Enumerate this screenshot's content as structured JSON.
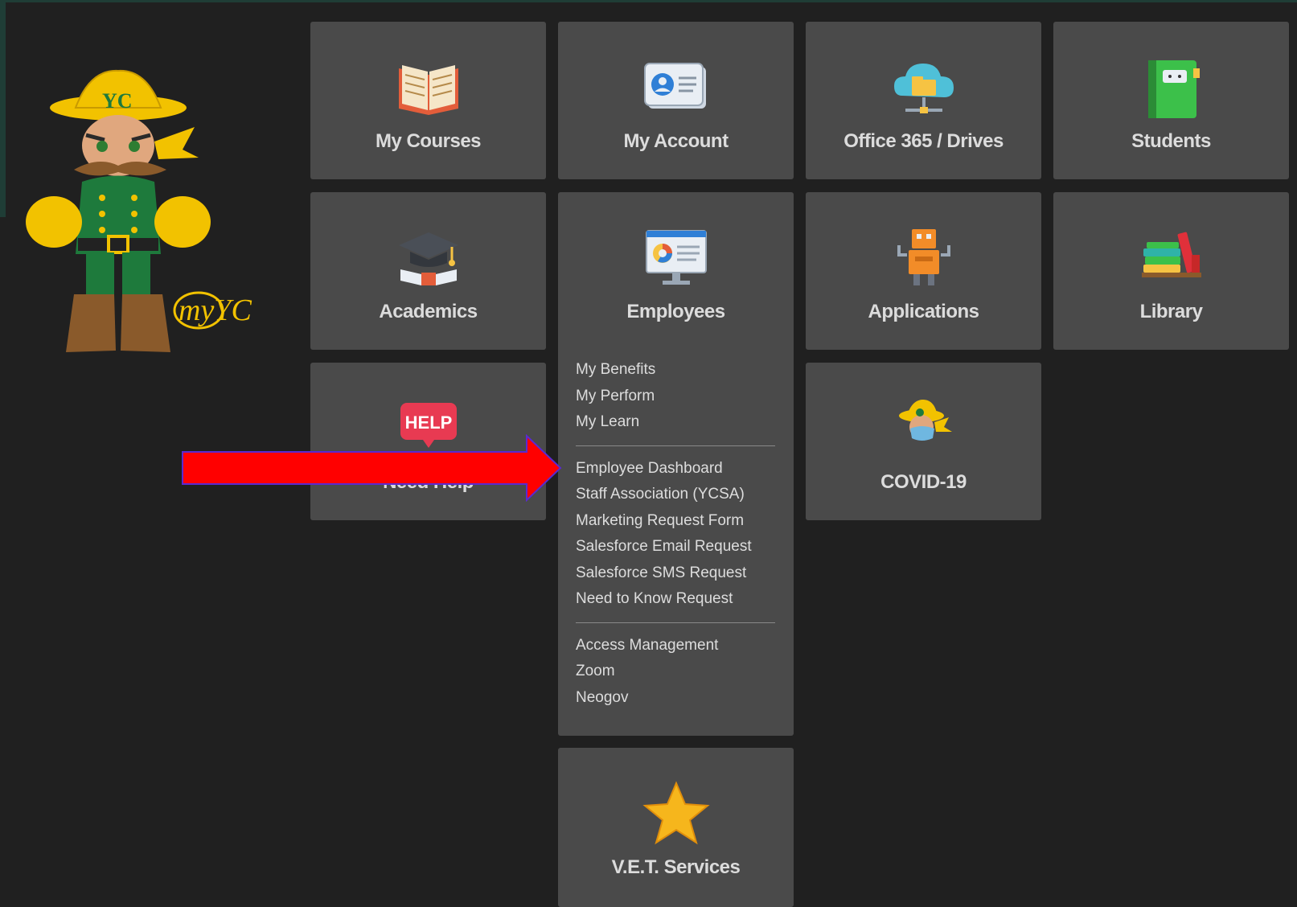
{
  "brand": {
    "logo_text": "myYC",
    "badge_text": "YC"
  },
  "tiles": {
    "my_courses": {
      "title": "My Courses",
      "icon": "book-icon"
    },
    "my_account": {
      "title": "My Account",
      "icon": "profile-card-icon"
    },
    "office365": {
      "title": "Office 365 / Drives",
      "icon": "cloud-drive-icon"
    },
    "students": {
      "title": "Students",
      "icon": "notebook-icon"
    },
    "academics": {
      "title": "Academics",
      "icon": "graduation-cap-icon"
    },
    "employees": {
      "title": "Employees",
      "icon": "monitor-chart-icon"
    },
    "applications": {
      "title": "Applications",
      "icon": "robot-icon"
    },
    "library": {
      "title": "Library",
      "icon": "books-icon"
    },
    "need_help": {
      "title": "Need Help",
      "icon": "help-bubble-icon",
      "badge": "HELP"
    },
    "covid": {
      "title": "COVID-19",
      "icon": "masked-mascot-icon"
    },
    "vet": {
      "title": "V.E.T. Services",
      "icon": "star-icon"
    }
  },
  "employees_menu": {
    "group1": [
      "My Benefits",
      "My Perform",
      "My Learn"
    ],
    "group2": [
      "Employee Dashboard",
      "Staff Association (YCSA)",
      "Marketing Request Form",
      "Salesforce Email Request",
      "Salesforce SMS Request",
      "Need to Know Request"
    ],
    "group3": [
      "Access Management",
      "Zoom",
      "Neogov"
    ]
  },
  "colors": {
    "background": "#202020",
    "tile": "#4a4a4a",
    "arrow": "#ff0000",
    "accent_gold": "#f2c200",
    "accent_green": "#1e7a3c"
  }
}
